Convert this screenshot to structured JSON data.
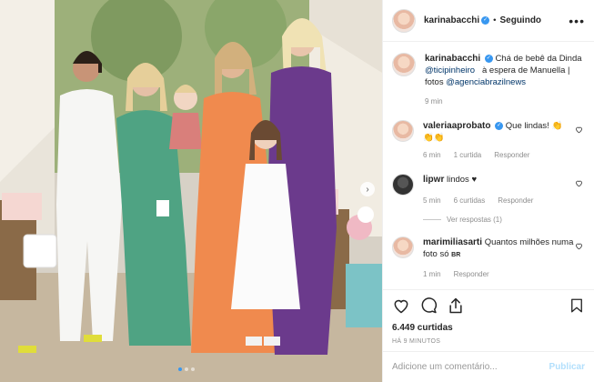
{
  "post": {
    "username": "karinabacchi",
    "follow_state": "Seguindo",
    "separator": "•",
    "more_icon": "more-options-icon"
  },
  "caption": {
    "username": "karinabacchi",
    "text_1": "Chá de bebê da Dinda",
    "mention_1": "@ticipinheiro",
    "text_2": "à espera de Manuella | fotos",
    "mention_2": "@agenciabrazilnews",
    "time": "9 min"
  },
  "comments": [
    {
      "username": "valeriaaprobato",
      "verified": true,
      "text": "Que lindas! 👏",
      "emoji_line": "👏👏",
      "time": "6 min",
      "likes": "1 curtida",
      "reply": "Responder"
    },
    {
      "username": "lipwr",
      "verified": false,
      "text": "lindos ♥",
      "time": "5 min",
      "likes": "6 curtidas",
      "reply": "Responder",
      "view_replies": "Ver respostas (1)"
    },
    {
      "username": "marimiliasarti",
      "verified": false,
      "text": "Quantos milhões numa foto só",
      "suffix": "BR",
      "time": "1 min",
      "reply": "Responder"
    }
  ],
  "stats": {
    "likes": "6.449 curtidas",
    "time_ago": "HÁ 9 MINUTOS"
  },
  "comment_box": {
    "placeholder": "Adicione um comentário...",
    "publish": "Publicar"
  },
  "colors": {
    "accent": "#3897f0",
    "publish_disabled": "#b2dffc",
    "muted": "#8e8e8e"
  }
}
